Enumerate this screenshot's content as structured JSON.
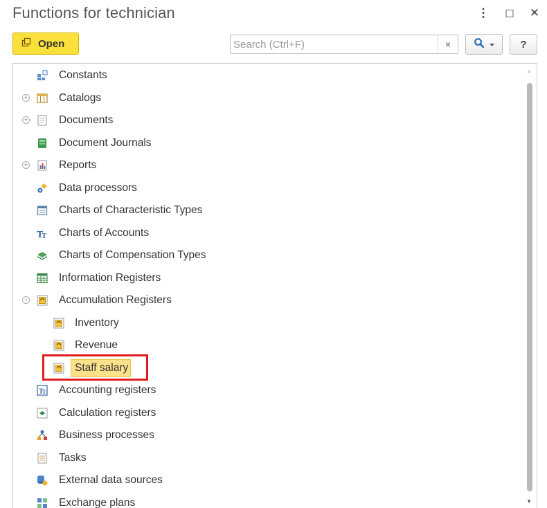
{
  "window": {
    "title": "Functions for technician",
    "more_glyph": "⋮",
    "maximize_glyph": "☐",
    "close_glyph": "✕"
  },
  "toolbar": {
    "open_label": "Open",
    "search_placeholder": "Search (Ctrl+F)",
    "search_value": "",
    "clear_glyph": "×",
    "help_label": "?"
  },
  "tree": {
    "items": [
      {
        "label": "Constants",
        "icon": "constants-icon",
        "expand": ""
      },
      {
        "label": "Catalogs",
        "icon": "catalogs-icon",
        "expand": "+"
      },
      {
        "label": "Documents",
        "icon": "documents-icon",
        "expand": "+"
      },
      {
        "label": "Document Journals",
        "icon": "document-journals-icon",
        "expand": ""
      },
      {
        "label": "Reports",
        "icon": "reports-icon",
        "expand": "+"
      },
      {
        "label": "Data processors",
        "icon": "data-processors-icon",
        "expand": ""
      },
      {
        "label": "Charts of Characteristic Types",
        "icon": "charts-characteristic-types-icon",
        "expand": ""
      },
      {
        "label": "Charts of Accounts",
        "icon": "charts-of-accounts-icon",
        "expand": ""
      },
      {
        "label": "Charts of Compensation Types",
        "icon": "charts-compensation-types-icon",
        "expand": ""
      },
      {
        "label": "Information Registers",
        "icon": "information-registers-icon",
        "expand": ""
      },
      {
        "label": "Accumulation Registers",
        "icon": "accumulation-registers-icon",
        "expand": "−"
      },
      {
        "label": "Inventory",
        "icon": "accumulation-register-icon",
        "expand": ""
      },
      {
        "label": "Revenue",
        "icon": "accumulation-register-icon",
        "expand": ""
      },
      {
        "label": "Staff salary",
        "icon": "accumulation-register-icon",
        "expand": "",
        "selected": true
      },
      {
        "label": "Accounting registers",
        "icon": "accounting-registers-icon",
        "expand": ""
      },
      {
        "label": "Calculation registers",
        "icon": "calculation-registers-icon",
        "expand": ""
      },
      {
        "label": "Business processes",
        "icon": "business-processes-icon",
        "expand": ""
      },
      {
        "label": "Tasks",
        "icon": "tasks-icon",
        "expand": ""
      },
      {
        "label": "External data sources",
        "icon": "external-data-sources-icon",
        "expand": ""
      },
      {
        "label": "Exchange plans",
        "icon": "exchange-plans-icon",
        "expand": ""
      }
    ]
  },
  "colors": {
    "open_button_bg": "#f9e03a",
    "selection_highlight": "#fbe289",
    "annotation_box": "#e01b1b",
    "search_icon": "#2b6cb8"
  }
}
